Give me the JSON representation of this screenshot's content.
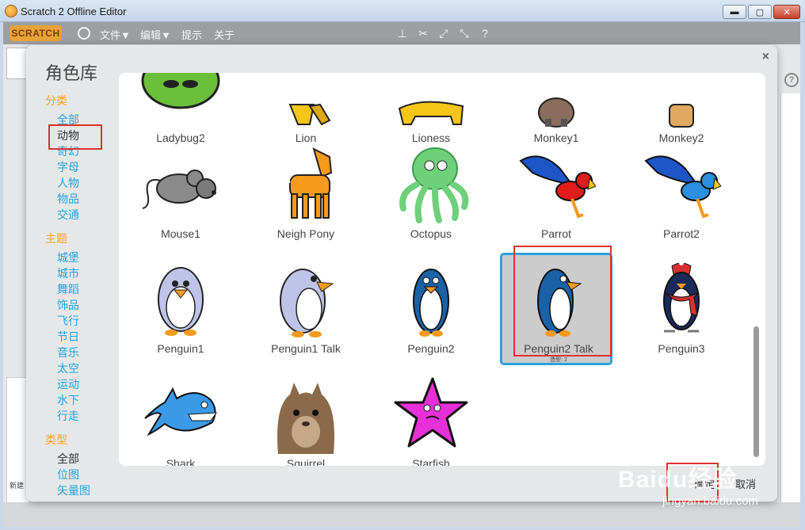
{
  "window": {
    "title": "Scratch 2 Offline Editor",
    "minimize": "▬",
    "maximize": "▢",
    "close": "✕"
  },
  "menubar": {
    "logo": "SCRATCH",
    "items": [
      "文件▼",
      "编辑▼",
      "提示",
      "关于"
    ],
    "tools": [
      "stamp-icon",
      "cut-icon",
      "grow-icon",
      "shrink-icon",
      "help-icon"
    ]
  },
  "background": {
    "new_label": "新建"
  },
  "dialog": {
    "title": "角色库",
    "close": "×",
    "sections": [
      {
        "header": "分类",
        "items": [
          "全部",
          "动物",
          "奇幻",
          "字母",
          "人物",
          "物品",
          "交通"
        ],
        "active": "动物"
      },
      {
        "header": "主题",
        "items": [
          "城堡",
          "城市",
          "舞蹈",
          "饰品",
          "飞行",
          "节日",
          "音乐",
          "太空",
          "运动",
          "水下",
          "行走"
        ]
      },
      {
        "header": "类型",
        "items": [
          "全部",
          "位图",
          "矢量图"
        ]
      }
    ],
    "sprites": [
      {
        "name": "Ladybug2",
        "icon": "ladybug-icon"
      },
      {
        "name": "Lion",
        "icon": "lion-icon"
      },
      {
        "name": "Lioness",
        "icon": "lioness-icon"
      },
      {
        "name": "Monkey1",
        "icon": "monkey-icon"
      },
      {
        "name": "Monkey2",
        "icon": "monkey-icon"
      },
      {
        "name": "Mouse1",
        "icon": "mouse-icon"
      },
      {
        "name": "Neigh Pony",
        "icon": "pony-icon"
      },
      {
        "name": "Octopus",
        "icon": "octopus-icon"
      },
      {
        "name": "Parrot",
        "icon": "parrot-icon"
      },
      {
        "name": "Parrot2",
        "icon": "parrot-icon"
      },
      {
        "name": "Penguin1",
        "icon": "penguin-icon"
      },
      {
        "name": "Penguin1 Talk",
        "icon": "penguin-icon"
      },
      {
        "name": "Penguin2",
        "icon": "penguin-icon"
      },
      {
        "name": "Penguin2 Talk",
        "icon": "penguin-icon",
        "selected": true,
        "subtext": "造型: 2"
      },
      {
        "name": "Penguin3",
        "icon": "penguin-icon"
      },
      {
        "name": "Shark",
        "icon": "shark-icon"
      },
      {
        "name": "Squirrel",
        "icon": "squirrel-icon"
      },
      {
        "name": "Starfish",
        "icon": "starfish-icon"
      }
    ],
    "ok": "确定",
    "cancel": "取消"
  },
  "watermark": {
    "brand": "Baidu经验",
    "url": "jingyan.baidu.com"
  },
  "colors": {
    "accent_blue": "#23a4e0",
    "header_orange": "#f9a11c",
    "highlight_red": "#e03030"
  }
}
